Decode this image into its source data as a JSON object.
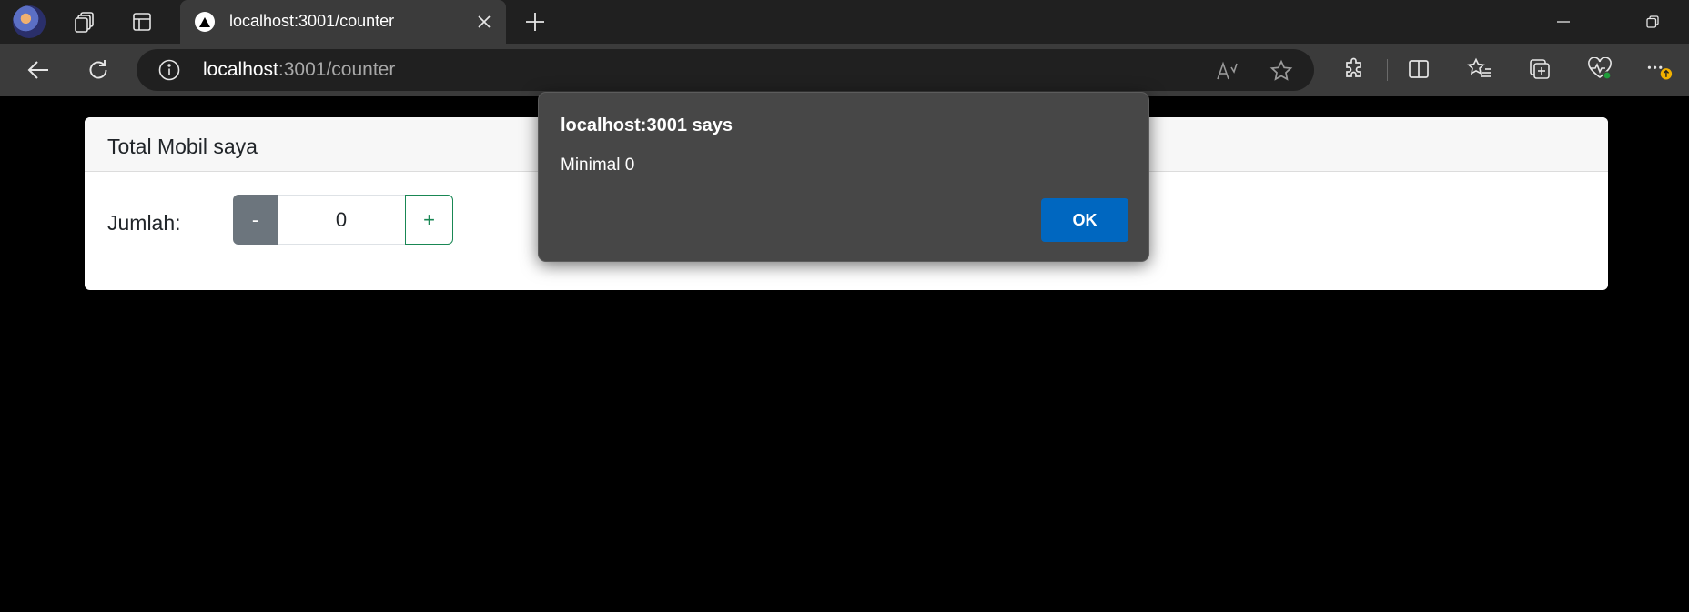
{
  "browser": {
    "tab": {
      "title": "localhost:3001/counter"
    },
    "address": {
      "host": "localhost",
      "rest": ":3001/counter"
    }
  },
  "page": {
    "card_title": "Total Mobil saya",
    "quantity_label": "Jumlah:",
    "minus_label": "-",
    "count_value": "0",
    "plus_label": "+"
  },
  "dialog": {
    "title": "localhost:3001 says",
    "message": "Minimal 0",
    "ok_label": "OK"
  },
  "icons": [
    "profile-avatar",
    "workspaces-icon",
    "tab-actions-icon",
    "site-favicon",
    "close-icon",
    "plus-icon",
    "minimize-icon",
    "restore-icon",
    "back-icon",
    "refresh-icon",
    "info-icon",
    "read-aloud-icon",
    "favorite-star-icon",
    "extensions-icon",
    "split-screen-icon",
    "favorites-icon",
    "collections-icon",
    "browser-essentials-icon",
    "more-icon"
  ],
  "colors": {
    "minus_button": "#6c757d",
    "plus_button": "#198754",
    "ok_button": "#0067c0",
    "update_badge": "#f2b100"
  }
}
